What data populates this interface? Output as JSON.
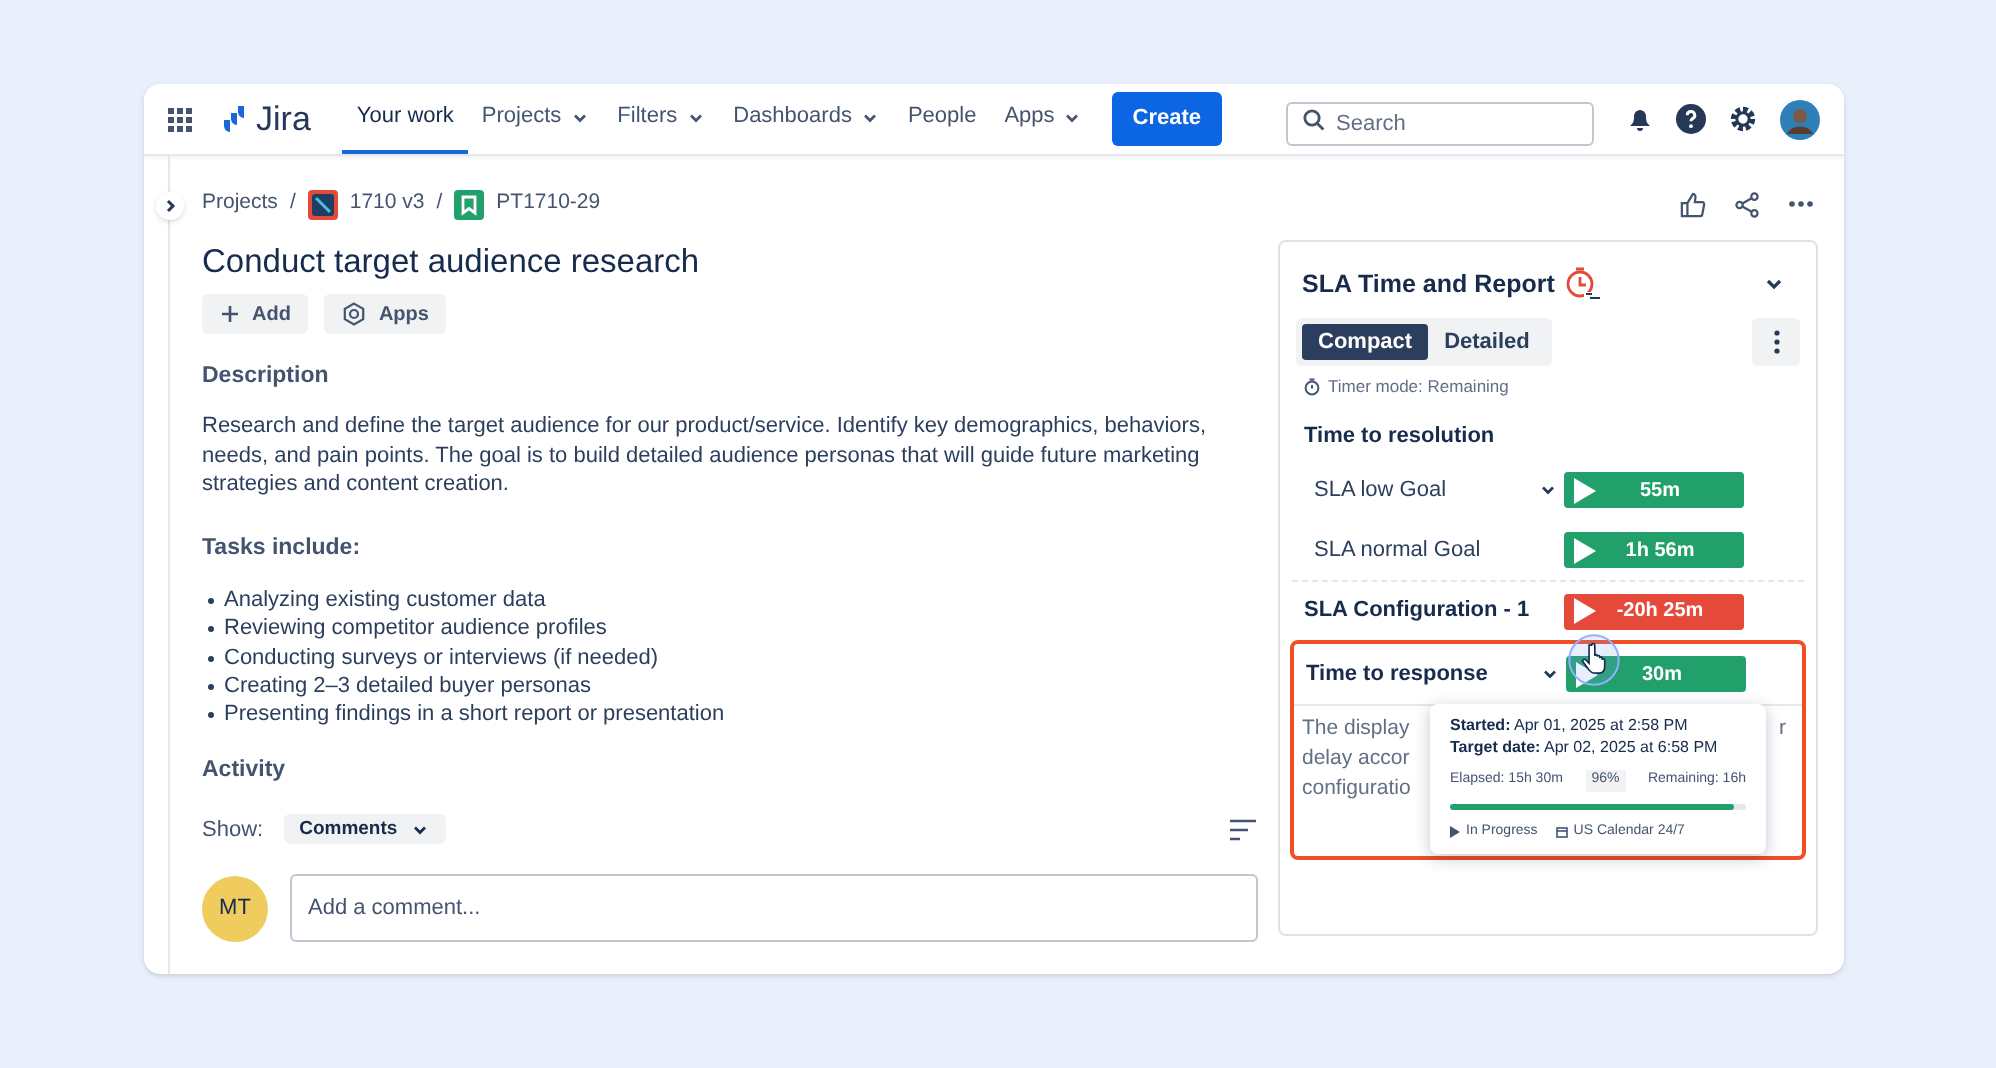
{
  "app": {
    "name": "Jira"
  },
  "nav": [
    {
      "label": "Your work",
      "selected": true,
      "has_menu": false
    },
    {
      "label": "Projects",
      "selected": false,
      "has_menu": true
    },
    {
      "label": "Filters",
      "selected": false,
      "has_menu": true
    },
    {
      "label": "Dashboards",
      "selected": false,
      "has_menu": true
    },
    {
      "label": "People",
      "selected": false,
      "has_menu": false
    },
    {
      "label": "Apps",
      "selected": false,
      "has_menu": true
    }
  ],
  "create_button": "Create",
  "search": {
    "placeholder": "Search"
  },
  "breadcrumbs": [
    {
      "label": "Projects",
      "kind": "text"
    },
    {
      "label": "1710 v3",
      "kind": "project",
      "separator": "/"
    },
    {
      "label": "PT1710-29",
      "kind": "issue",
      "separator": "/"
    }
  ],
  "issue": {
    "title": "Conduct target audience research",
    "actions": [
      "Add",
      "Apps"
    ],
    "description_heading": "Description",
    "description": "Research and define the target audience for our product/service. Identify key demographics, behaviors, needs, and pain points. The goal is to build detailed audience personas that will guide future marketing strategies and content creation.",
    "tasks_heading": "Tasks include:",
    "tasks": [
      "Analyzing existing customer data",
      "Reviewing competitor audience profiles",
      "Conducting surveys or interviews (if needed)",
      "Creating 2–3 detailed buyer personas",
      "Presenting findings in a short report or presentation"
    ],
    "activity_heading": "Activity",
    "show_label": "Show:",
    "show_filter": "Comments",
    "comment": {
      "avatar": "MT",
      "placeholder": "Add a comment..."
    }
  },
  "sla_panel": {
    "title": "SLA Time and Report",
    "views": [
      {
        "label": "Compact",
        "selected": true
      },
      {
        "label": "Detailed",
        "selected": false
      }
    ],
    "timer_mode": "Timer mode: Remaining",
    "rows": [
      {
        "kind": "heading",
        "name": "Time to resolution"
      },
      {
        "kind": "goal",
        "name": "SLA low Goal",
        "expandable": true,
        "timer": "55m",
        "color": "#22a06b",
        "highlighted": false
      },
      {
        "kind": "goal",
        "name": "SLA normal Goal",
        "expandable": false,
        "timer": "1h 56m",
        "color": "#22a06b",
        "highlighted": false
      },
      {
        "kind": "config",
        "name": "SLA Configuration - 1",
        "expandable": false,
        "timer": "-20h 25m",
        "color": "#e5493a",
        "highlighted": false
      },
      {
        "kind": "config",
        "name": "Time to response",
        "expandable": true,
        "timer": "30m",
        "color": "#22a06b",
        "highlighted": true
      }
    ],
    "note_fragments": [
      "The display",
      "delay accor",
      "configuratio"
    ],
    "note_tail": "r",
    "popover": {
      "started_label": "Started:",
      "started": "Apr 01, 2025 at 2:58 PM",
      "target_label": "Target date:",
      "target": "Apr 02, 2025 at 6:58 PM",
      "elapsed": "Elapsed: 15h 30m",
      "percent": "96%",
      "remaining": "Remaining: 16h",
      "level": 0.96,
      "status": "In Progress",
      "calendar": "US Calendar 24/7"
    }
  }
}
